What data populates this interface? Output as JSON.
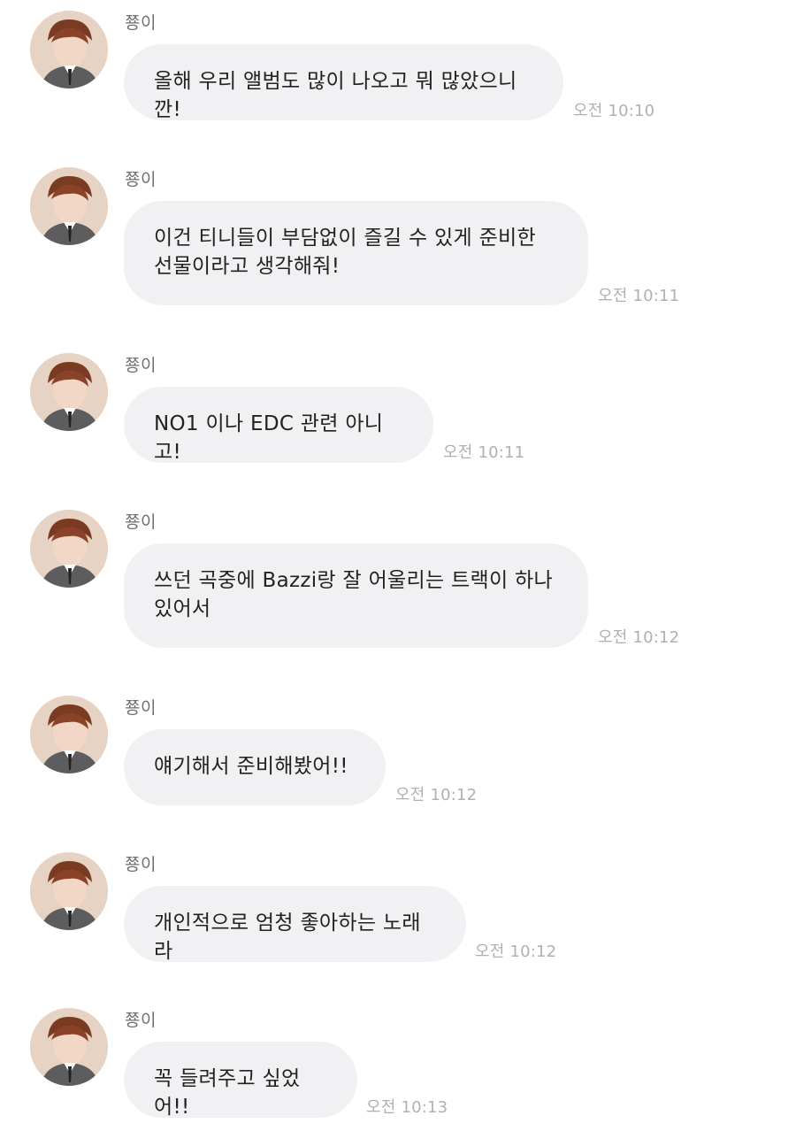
{
  "conversation": {
    "messages": [
      {
        "sender": "쭁이",
        "text": "올해 우리 앨범도 많이 나오고 뭐 많았으니깐!",
        "time": "오전 10:10"
      },
      {
        "sender": "쭁이",
        "text": "이건 티니들이 부담없이 즐길 수 있게 준비한\n선물이라고 생각해줘!",
        "time": "오전 10:11"
      },
      {
        "sender": "쭁이",
        "text": "NO1 이나 EDC 관련 아니고!",
        "time": "오전 10:11"
      },
      {
        "sender": "쭁이",
        "text": "쓰던 곡중에 Bazzi랑 잘 어울리는 트랙이 하나\n있어서",
        "time": "오전 10:12"
      },
      {
        "sender": "쭁이",
        "text": "얘기해서 준비해봤어!!",
        "time": "오전 10:12"
      },
      {
        "sender": "쭁이",
        "text": "개인적으로 엄청 좋아하는 노래라",
        "time": "오전 10:12"
      },
      {
        "sender": "쭁이",
        "text": "꼭 들려주고 싶었어!!",
        "time": "오전 10:13"
      }
    ]
  }
}
